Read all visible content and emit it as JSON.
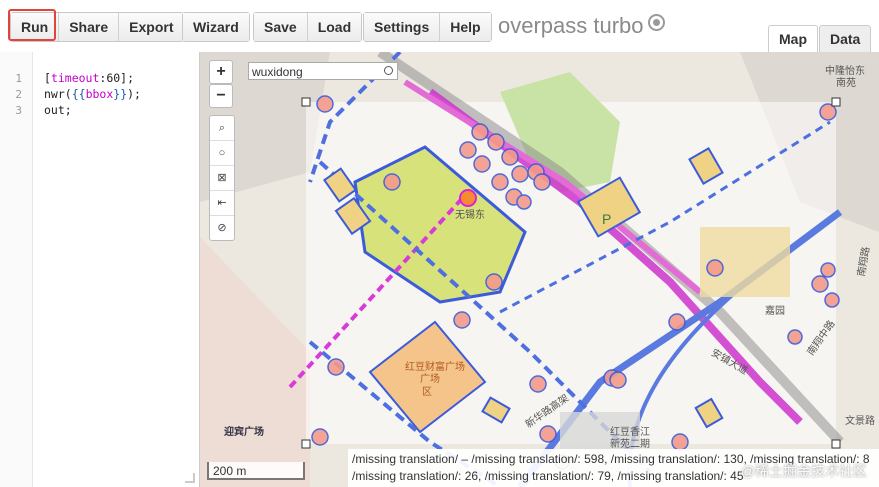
{
  "toolbar": {
    "run": "Run",
    "share": "Share",
    "export": "Export",
    "wizard": "Wizard",
    "save": "Save",
    "load": "Load",
    "settings": "Settings",
    "help": "Help"
  },
  "app_title": "overpass turbo",
  "tabs": {
    "map": "Map",
    "data": "Data"
  },
  "editor": {
    "lines": [
      "1",
      "2",
      "3"
    ],
    "line1_a": "[",
    "line1_kw": "timeout",
    "line1_b": ":60];",
    "line2_a": "nwr(",
    "line2_br": "{{",
    "line2_kw": "bbox",
    "line2_br2": "}}",
    "line2_b": ");",
    "line3": "out;"
  },
  "map": {
    "zoom_in": "+",
    "zoom_out": "−",
    "search_value": "wuxidong",
    "scale": "200 m",
    "labels": {
      "station": "无锡东",
      "plaza": "红豆财富广场",
      "plaza2": "区",
      "plaza_full": "广场",
      "yingbin": "迎宾广场",
      "road_xinhe": "新华路高架",
      "hongdou2": "红豆香江",
      "hongdou2b": "新苑二期",
      "north_top": "中隆怡东",
      "north_top2": "南苑",
      "road_right": "文景路",
      "road_right2": "南翔路",
      "road_right3": "南翔中路",
      "road_side": "安镇大道",
      "jiayuan": "嘉园",
      "parking": "P"
    },
    "accent": "#3b5bdb",
    "status": {
      "line1": "/missing translation/ – /missing translation/: 598, /missing translation/: 130, /missing translation/: 8",
      "line2": "/missing translation/: 26, /missing translation/: 79, /missing translation/: 45"
    },
    "watermark": "@稀土掘金技术社区"
  }
}
